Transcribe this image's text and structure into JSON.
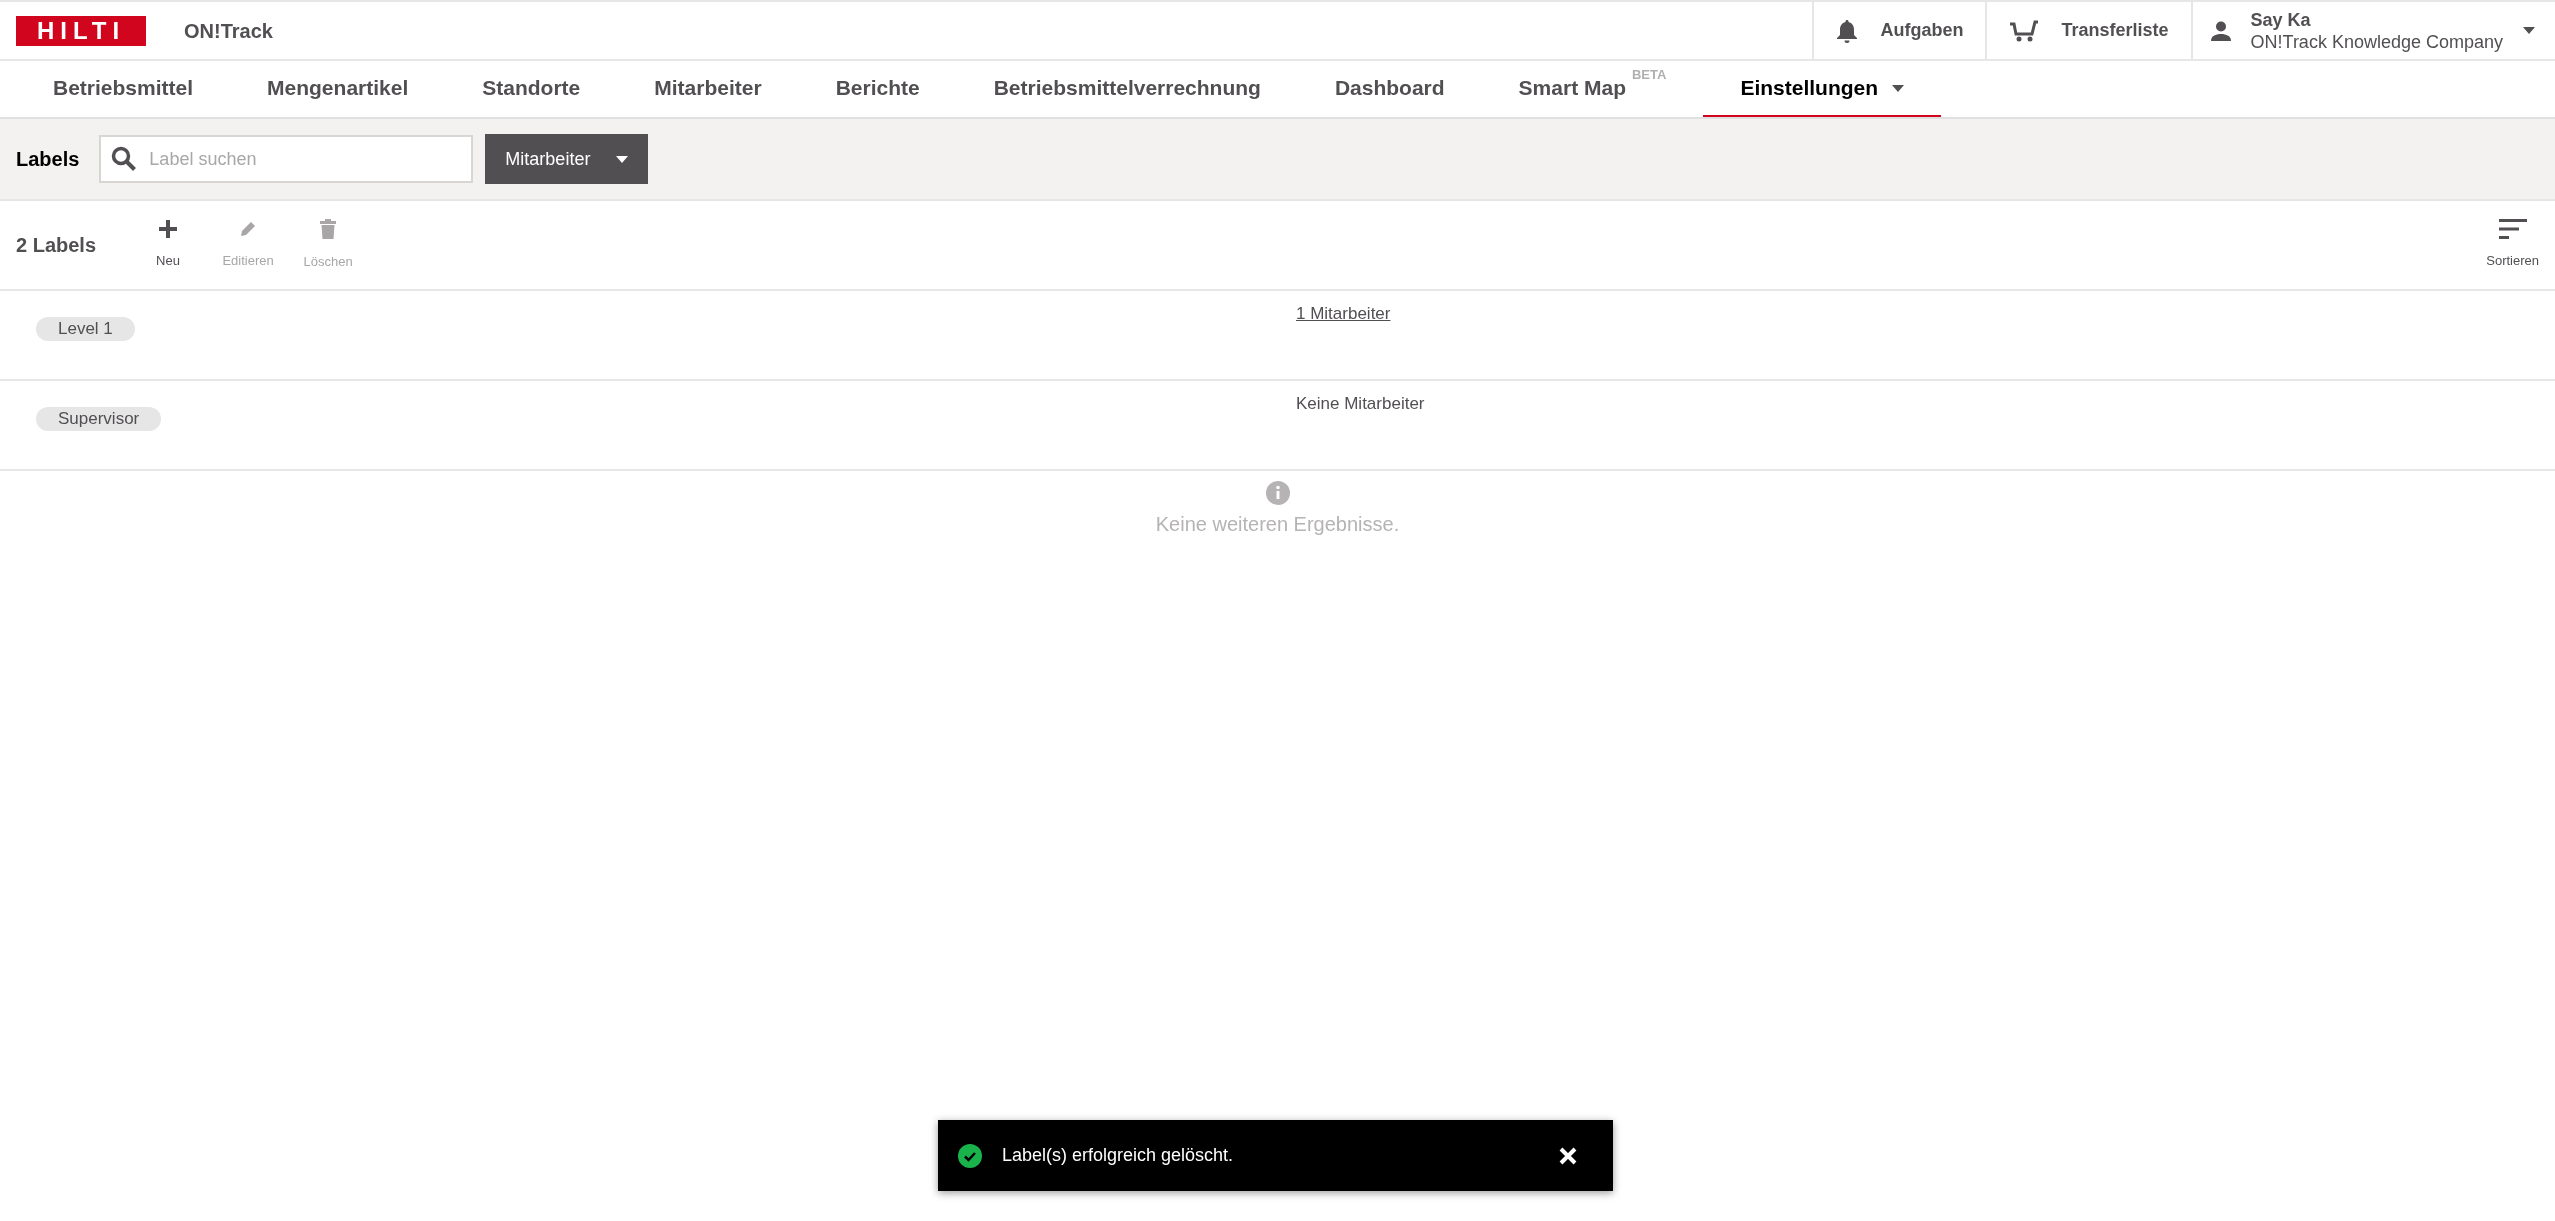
{
  "header": {
    "logo": "HILTI",
    "app_name": "ON!Track",
    "actions": [
      {
        "kind": "bell",
        "label": "Aufgaben"
      },
      {
        "kind": "cart",
        "label": "Transferliste"
      }
    ],
    "user": {
      "name": "Say Ka",
      "company": "ON!Track Knowledge Company"
    }
  },
  "nav": [
    {
      "label": "Betriebsmittel",
      "selected": false
    },
    {
      "label": "Mengenartikel",
      "selected": false
    },
    {
      "label": "Standorte",
      "selected": false
    },
    {
      "label": "Mitarbeiter",
      "selected": false
    },
    {
      "label": "Berichte",
      "selected": false
    },
    {
      "label": "Betriebsmittelverrechnung",
      "selected": false
    },
    {
      "label": "Dashboard",
      "selected": false
    },
    {
      "label": "Smart Map",
      "sup": "BETA",
      "selected": false
    },
    {
      "label": "Einstellungen",
      "dropdown": true,
      "selected": true
    }
  ],
  "filter": {
    "title": "Labels",
    "search": {
      "placeholder": "Label suchen"
    },
    "type_select": "Mitarbeiter"
  },
  "toolbar": {
    "count": "2 Labels",
    "actions": [
      {
        "kind": "plus",
        "label": "Neu",
        "disabled": false
      },
      {
        "kind": "pencil",
        "label": "Editieren",
        "disabled": true
      },
      {
        "kind": "trash",
        "label": "Löschen",
        "disabled": true
      }
    ],
    "sort": "Sortieren"
  },
  "rows": [
    {
      "label": "Level 1",
      "employees": "1 Mitarbeiter",
      "linked": true
    },
    {
      "label": "Supervisor",
      "employees": "Keine Mitarbeiter",
      "linked": false
    }
  ],
  "end_message": "Keine weiteren Ergebnisse.",
  "toast": {
    "message": "Label(s) erfolgreich gelöscht."
  }
}
